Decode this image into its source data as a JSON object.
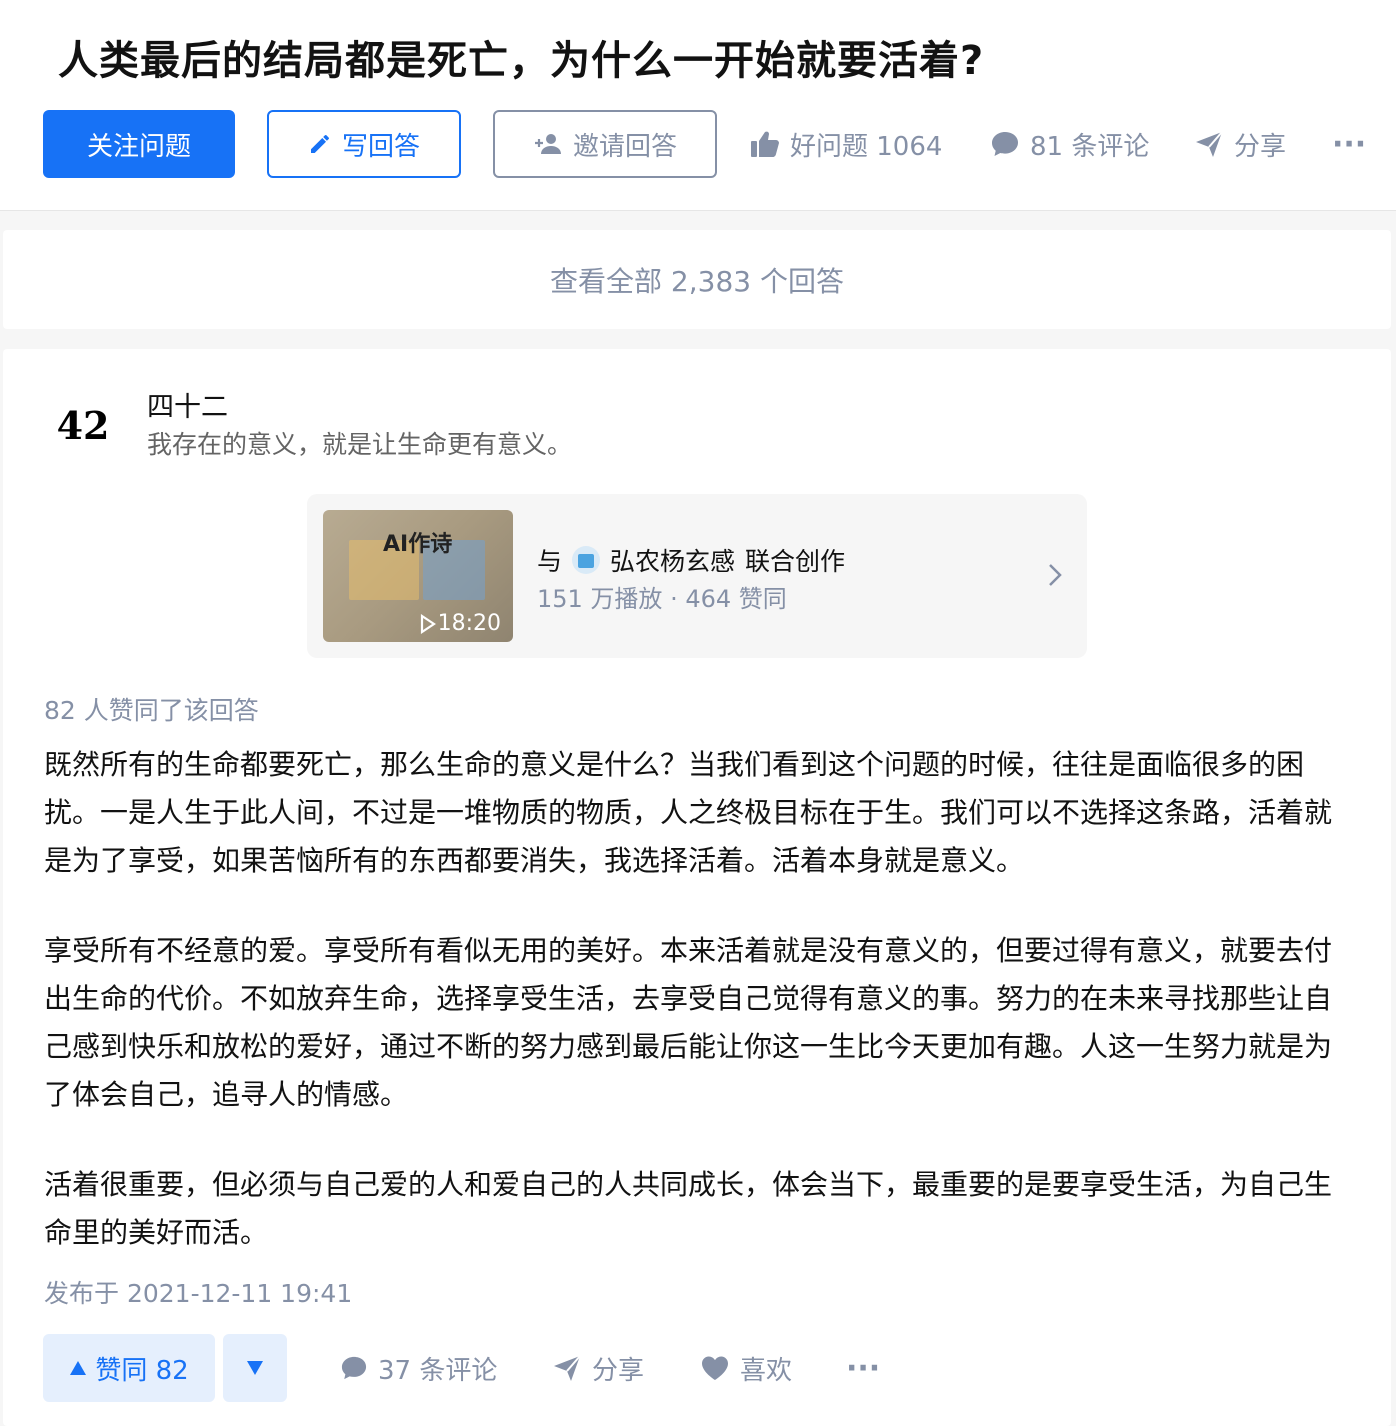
{
  "question": {
    "title": "人类最后的结局都是死亡，为什么一开始就要活着?",
    "follow_label": "关注问题",
    "write_label": "写回答",
    "invite_label": "邀请回答",
    "good_question_label": "好问题 1064",
    "comments_label": "81 条评论",
    "share_label": "分享",
    "more_label": "···"
  },
  "view_all": {
    "label": "查看全部 2,383 个回答"
  },
  "answer": {
    "author": {
      "avatar_text": "42",
      "name": "四十二",
      "bio": "我存在的意义，就是让生命更有意义。"
    },
    "video": {
      "thumb_title": "AI作诗",
      "duration": "18:20",
      "with_label": "与",
      "coauthor": "弘农杨玄感",
      "collab_label": "联合创作",
      "stats": "151 万播放 · 464 赞同"
    },
    "votes_line": "82 人赞同了该回答",
    "paragraphs": [
      "既然所有的生命都要死亡，那么生命的意义是什么？当我们看到这个问题的时候，往往是面临很多的困扰。一是人生于此人间，不过是一堆物质的物质，人之终极目标在于生。我们可以不选择这条路，活着就是为了享受，如果苦恼所有的东西都要消失，我选择活着。活着本身就是意义。",
      "享受所有不经意的爱。享受所有看似无用的美好。本来活着就是没有意义的，但要过得有意义，就要去付出生命的代价。不如放弃生命，选择享受生活，去享受自己觉得有意义的事。努力的在未来寻找那些让自己感到快乐和放松的爱好，通过不断的努力感到最后能让你这一生比今天更加有趣。人这一生努力就是为了体会自己，追寻人的情感。",
      "活着很重要，但必须与自己爱的人和爱自己的人共同成长，体会当下，最重要的是要享受生活，为自己生命里的美好而活。"
    ],
    "publish_time": "发布于 2021-12-11 19:41",
    "vote_up_label": "赞同 82",
    "comments_label": "37 条评论",
    "share_label": "分享",
    "like_label": "喜欢",
    "more_label": "···"
  },
  "colors": {
    "brand": "#1772f6",
    "muted": "#8590a6",
    "vote_bg": "#e5effd"
  }
}
